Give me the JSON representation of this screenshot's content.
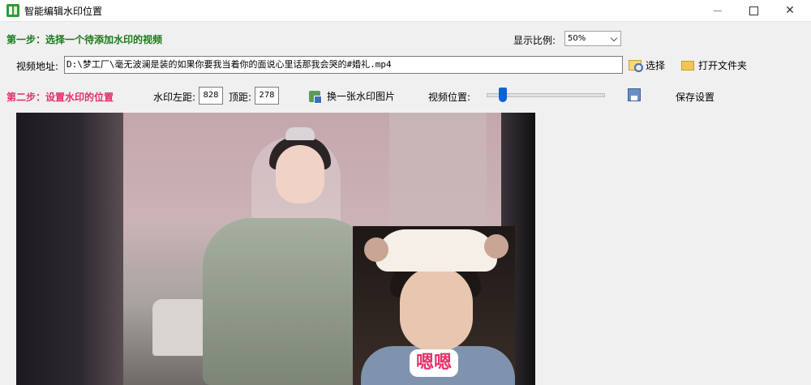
{
  "window": {
    "title": "智能编辑水印位置",
    "minimize_icon": "minimize-icon",
    "maximize_icon": "maximize-icon",
    "close_icon": "close-icon",
    "close_glyph": "✕"
  },
  "step1": {
    "heading": "第一步：选择一个待添加水印的视频",
    "ratio_label": "显示比例:",
    "ratio_value": "50%",
    "address_label": "视频地址:",
    "address_value": "D:\\梦工厂\\毫无波澜是装的如果你要我当着你的面说心里话那我会哭的#婚礼.mp4",
    "select_label": "选择",
    "open_folder_label": "打开文件夹"
  },
  "step2": {
    "heading": "第二步：设置水印的位置",
    "left_label": "水印左距:",
    "left_value": "828",
    "top_label": "顶距:",
    "top_value": "278",
    "swap_label": "换一张水印图片",
    "position_label": "视频位置:",
    "position_value": 0.14,
    "save_label": "保存设置"
  },
  "preview": {
    "watermark_caption": "嗯嗯"
  },
  "colors": {
    "step1": "#1a7a1a",
    "step2": "#e0306a",
    "slider_thumb": "#0a64d8"
  }
}
